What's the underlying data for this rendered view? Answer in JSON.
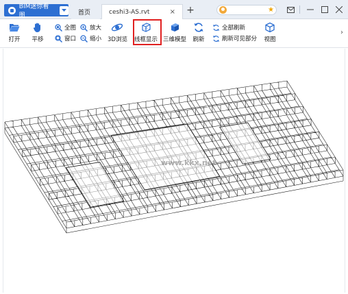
{
  "titlebar": {
    "app_name": "BIM迷你看图",
    "tabs": [
      {
        "label": "首页"
      },
      {
        "label": "ceshi3-AS.rvt",
        "close": "×"
      }
    ],
    "add_tab": "+",
    "window_controls": [
      "mail-icon",
      "minimize-icon",
      "maximize-icon",
      "close-icon"
    ]
  },
  "toolbar": {
    "open": "打开",
    "pan": "平移",
    "full": "全图",
    "window": "窗口",
    "zoom_in": "放大",
    "zoom_out": "缩小",
    "browse3d": "3D浏览",
    "wireframe": "线框显示",
    "model3d": "三维模型",
    "refresh": "刷新",
    "refresh_all": "全部刷新",
    "refresh_visible": "刷新可见部分",
    "view": "视图",
    "scroll": "›",
    "highlighted": "wireframe",
    "highlight_color": "#e02020"
  },
  "viewport": {
    "watermark": "www.kkx.net"
  },
  "colors": {
    "accent": "#2d6fd2",
    "titlebar_bg": "#e9eef5"
  }
}
